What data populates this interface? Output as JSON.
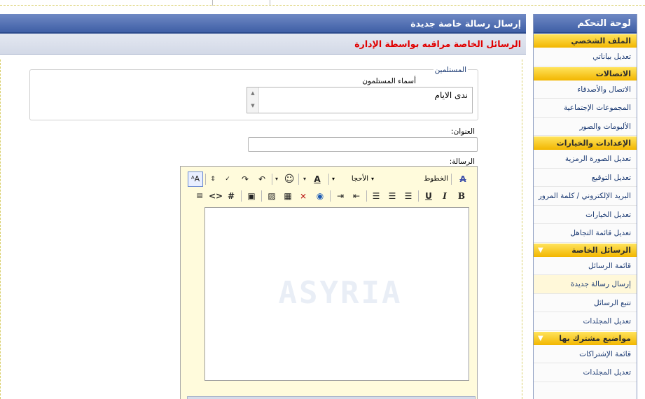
{
  "sidebar": {
    "title": "لوحة التحكم",
    "groups": [
      {
        "section": "الملف الشخصي",
        "items": [
          "تعديل بياناتي"
        ]
      },
      {
        "section": "الاتصالات",
        "items": [
          "الاتصال والأصدقاء",
          "المجموعات الإجتماعية",
          "الألبومات والصور"
        ]
      },
      {
        "section": "الإعدادات والخيارات",
        "items": [
          "تعديل الصورة الرمزية",
          "تعديل التوقيع",
          "البريد الإلكتروني / كلمة المرور",
          "تعديل الخيارات",
          "تعديل قائمة التجاهل"
        ]
      },
      {
        "section": "الرسائل الخاصة",
        "items": [
          "قائمة الرسائل",
          "إرسال رسالة جديدة",
          "تتبع الرسائل",
          "تعديل المجلدات"
        ]
      },
      {
        "section": "مواضيع مشترك بها",
        "items": [
          "قائمة الإشتراكات",
          "تعديل المجلدات"
        ]
      }
    ]
  },
  "main": {
    "title": "إرسال رسالة خاصة جديدة",
    "notice": "الرسائل الخاصة مراقبه بواسطة الإدارة",
    "recipients": {
      "legend": "المستلمين",
      "label": "أسماء المستلمون",
      "value": "ندى الايام"
    },
    "title_label": "العنوان:",
    "title_value": "",
    "message_label": "الرسالة:",
    "editor": {
      "font_combo": "الخطوط",
      "size_combo": "الأحجا",
      "watermark": "ASYRIA"
    }
  }
}
